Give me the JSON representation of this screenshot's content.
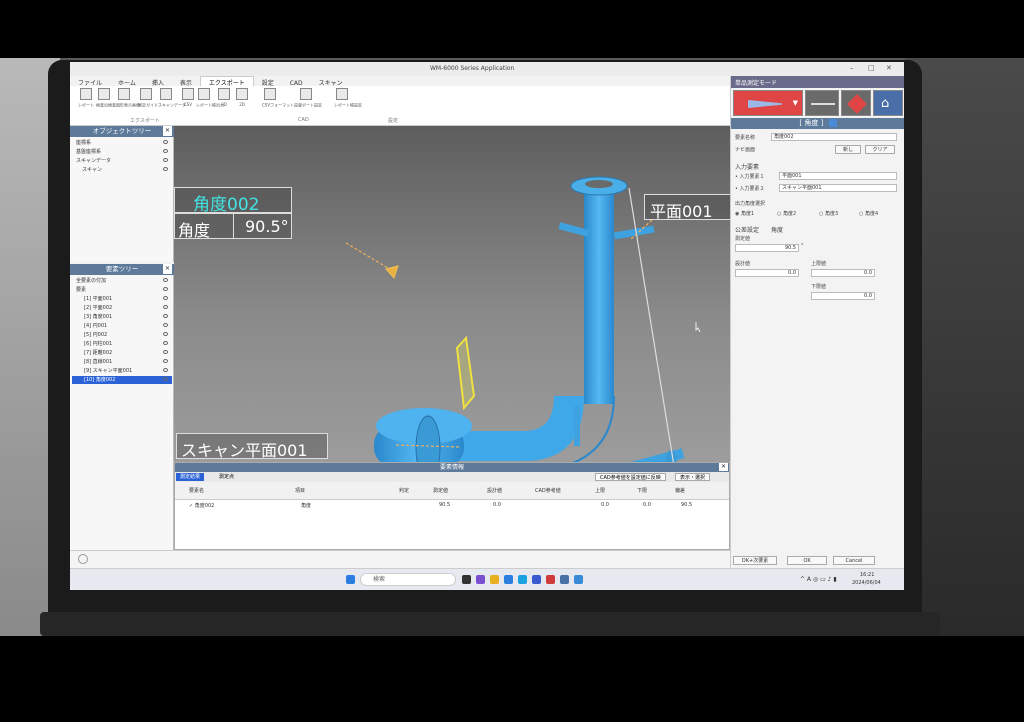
{
  "window": {
    "title": "WM-6000 Series Application",
    "tabs": [
      "ファイル",
      "ホーム",
      "挿入",
      "表示",
      "エクスポート",
      "設定",
      "CAD",
      "スキャン"
    ],
    "active_tab": "エクスポート",
    "ribbon_groups": [
      "エクスポート",
      "CAD",
      "設定"
    ],
    "ribbon_buttons": [
      {
        "label": "レポート",
        "icon": "report-icon"
      },
      {
        "label": "検査出検査",
        "icon": "inspection-icon"
      },
      {
        "label": "図形表示画像",
        "icon": "image-icon"
      },
      {
        "label": "測定ガイド",
        "icon": "guide-icon"
      },
      {
        "label": "スキャンデータ",
        "icon": "scan-data-icon"
      },
      {
        "label": "CSV",
        "icon": "csv-icon"
      },
      {
        "label": "レポート帳出力",
        "icon": "report-book-icon"
      },
      {
        "label": "3D",
        "icon": "cube-icon"
      },
      {
        "label": "2D",
        "icon": "flat-icon"
      },
      {
        "label": "CSVフォーマット設定",
        "icon": "csv-format-icon"
      },
      {
        "label": "レポート設定",
        "icon": "report-settings-icon"
      },
      {
        "label": "レポート帳設定",
        "icon": "report-book-settings-icon"
      }
    ]
  },
  "object_tree": {
    "title": "オブジェクトツリー",
    "items": [
      "座標系",
      "基盤座標系",
      "スキャンデータ",
      "スキャン"
    ]
  },
  "element_tree": {
    "title": "要素ツリー",
    "items": [
      "全要素の付加",
      "要素",
      "[1] 平面001",
      "[2] 平面002",
      "[3] 角度001",
      "[4] 円001",
      "[5] 円002",
      "[6] 円柱001",
      "[7] 距離002",
      "[8] 直線001",
      "[9] スキャン平面001",
      "[10] 角度002"
    ],
    "selected": "[10] 角度002"
  },
  "viewport": {
    "callout_angle_name": "角度002",
    "callout_angle_label": "角度",
    "callout_angle_value": "90.5°",
    "callout_plane": "平面001",
    "callout_scan_plane": "スキャン平面001"
  },
  "right_panel": {
    "mode_title": "単品測定モード",
    "section_title": "[ 角度 ]",
    "element_name_label": "要素名称",
    "element_name_value": "角度002",
    "nav_label": "ナビ画面",
    "nav_buttons": [
      "新し",
      "クリア"
    ],
    "input_section": "入力要素",
    "input1_label": "入力要素１",
    "input1_value": "平面001",
    "input2_label": "入力要素２",
    "input2_value": "スキャン平面001",
    "output_section": "出力角度選択",
    "angle_options": [
      "角度1",
      "角度2",
      "角度3",
      "角度4"
    ],
    "tolerance_label": "公差設定",
    "tolerance_type": "角度",
    "measured_label": "測定値",
    "measured_value": "90.5",
    "design_label": "設計値",
    "design_value": "0.0",
    "upper_label": "上限値",
    "upper_value": "0.0",
    "lower_label": "下限値",
    "lower_value": "0.0",
    "footer_buttons": [
      "OK+次要素",
      "OK",
      "Cancel"
    ]
  },
  "element_info": {
    "title": "要素情報",
    "tabs": [
      "測定結果",
      "測定点"
    ],
    "cad_btn": "CAD参考値を設定値に反映",
    "export_btn": "表示・選択",
    "columns": [
      "要素名",
      "項目",
      "判定",
      "測定値",
      "設計値",
      "CAD参考値",
      "上限",
      "下限",
      "偏差"
    ],
    "row": [
      "角度002",
      "角度",
      "",
      "90.5",
      "0.0",
      "",
      "0.0",
      "0.0",
      "90.5"
    ]
  },
  "taskbar": {
    "search_placeholder": "検索",
    "time": "16:21",
    "date": "2024/06/04"
  },
  "colors": {
    "pipe": "#3fa8e8",
    "callout_name": "#42e3e3",
    "header_blue": "#5d7a9a",
    "select_blue": "#2b63d6",
    "mode_red": "#e04545"
  }
}
